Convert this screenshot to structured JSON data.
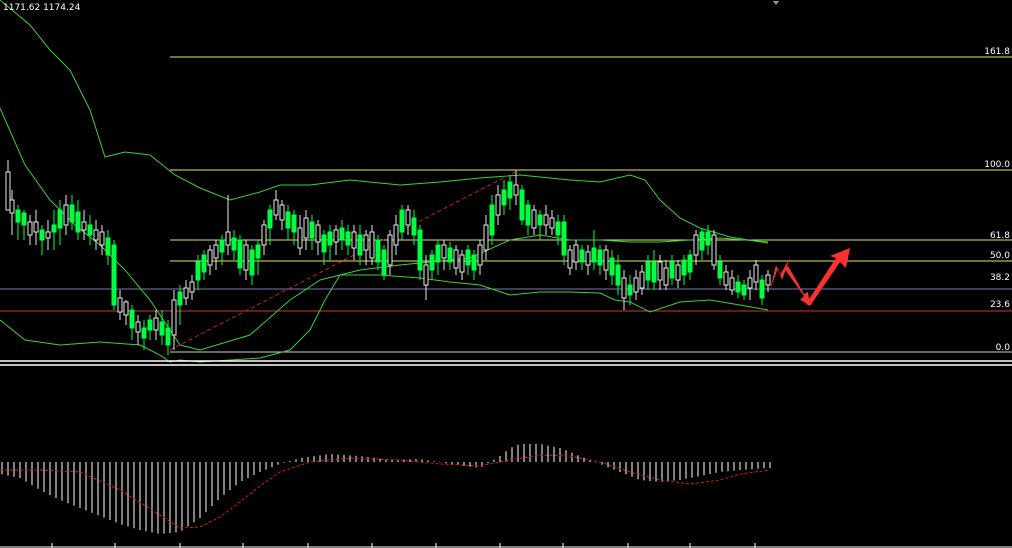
{
  "header": {
    "quote": "1171.62 1174.24"
  },
  "fib_levels": [
    {
      "label": "161.8",
      "color": "#e6e65a"
    },
    {
      "label": "100.0",
      "color": "#e6e65a"
    },
    {
      "label": "61.8",
      "color": "#e6e65a"
    },
    {
      "label": "50.0",
      "color": "#e6e65a"
    },
    {
      "label": "38.2",
      "color": "#7a7ab0"
    },
    {
      "label": "23.6",
      "color": "#e03030"
    },
    {
      "label": "0.0",
      "color": "#d0d0d0"
    }
  ],
  "colors": {
    "bull": "#e8e8e8",
    "bear": "#00ff40",
    "band": "#3ccf3c",
    "trend": "#d02020",
    "arrow": "#ff3030",
    "macd_bar": "#ffffff",
    "signal": "#d02020"
  },
  "chart_data": {
    "type": "candlestick",
    "title": "",
    "xlabel": "",
    "ylabel": "",
    "grid": false,
    "fibonacci_retracement": [
      "161.8",
      "100.0",
      "61.8",
      "50.0",
      "38.2",
      "23.6",
      "0.0"
    ],
    "indicators": [
      "Bollinger Bands",
      "MACD histogram",
      "MACD signal"
    ]
  }
}
